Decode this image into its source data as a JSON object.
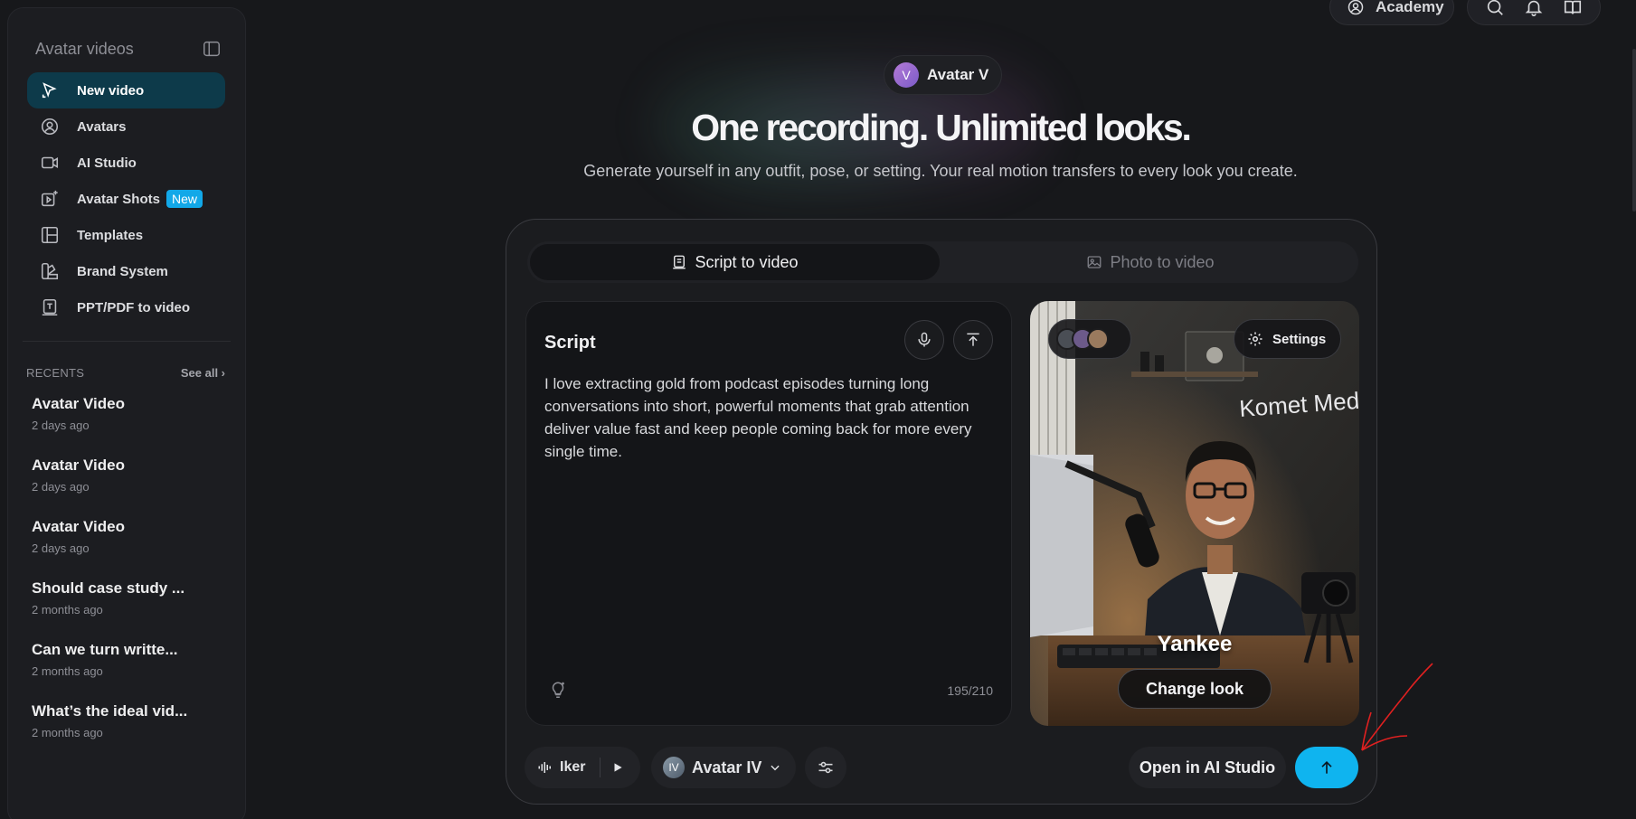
{
  "sidebar": {
    "title": "Avatar videos",
    "nav": [
      {
        "label": "New video",
        "icon": "cursor-icon",
        "active": true
      },
      {
        "label": "Avatars",
        "icon": "user-circle-icon"
      },
      {
        "label": "AI Studio",
        "icon": "video-camera-icon"
      },
      {
        "label": "Avatar Shots",
        "icon": "sparkle-video-icon",
        "badge": "New"
      },
      {
        "label": "Templates",
        "icon": "layout-icon"
      },
      {
        "label": "Brand System",
        "icon": "palette-icon"
      },
      {
        "label": "PPT/PDF to video",
        "icon": "document-icon"
      }
    ],
    "recents_label": "RECENTS",
    "see_all": "See all ›",
    "recents": [
      {
        "title": "Avatar Video",
        "date": "2 days ago"
      },
      {
        "title": "Avatar Video",
        "date": "2 days ago"
      },
      {
        "title": "Avatar Video",
        "date": "2 days ago"
      },
      {
        "title": "Should case study ...",
        "date": "2 months ago"
      },
      {
        "title": "Can we turn writte...",
        "date": "2 months ago"
      },
      {
        "title": "What’s the ideal vid...",
        "date": "2 months ago"
      }
    ]
  },
  "topbar": {
    "academy": "Academy"
  },
  "hero": {
    "pill_initial": "V",
    "pill_label": "Avatar V",
    "title": "One recording. Unlimited looks.",
    "subtitle": "Generate yourself in any outfit, pose, or setting. Your real motion transfers to every look you create."
  },
  "tabs": {
    "script": "Script to video",
    "photo": "Photo to video"
  },
  "script": {
    "title": "Script",
    "text": "I love extracting gold from podcast episodes turning long conversations into short, powerful moments that grab attention deliver value fast and keep people coming back for more every single time.",
    "counter": "195/210"
  },
  "preview": {
    "settings": "Settings",
    "avatar_name": "Yankee",
    "change_look": "Change look",
    "wall_sign": "Komet Med"
  },
  "bottom": {
    "voice": "Iker",
    "model_initials": "IV",
    "model": "Avatar IV",
    "open_studio": "Open in AI Studio"
  },
  "colors": {
    "accent": "#0fb4ef",
    "active_nav": "#0d3a4a",
    "badge": "#12a8e8",
    "annotation": "#e02020"
  }
}
